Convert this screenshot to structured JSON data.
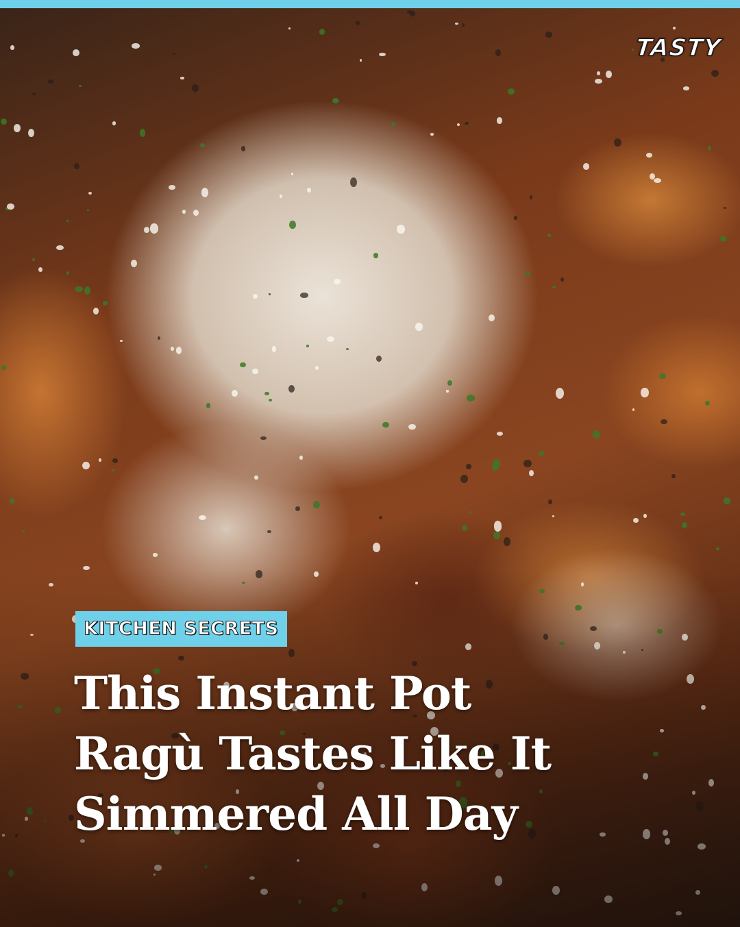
{
  "brand": {
    "logo_text": "TASTY",
    "accent_color": "#6fd0ea"
  },
  "post": {
    "category_tag": "KITCHEN SECRETS",
    "headline_lines": [
      "This Instant Pot",
      "Ragù Tastes Like It",
      "Simmered All Day"
    ]
  },
  "photo": {
    "subject": "rigatoni-ragu-parmesan-photo"
  }
}
